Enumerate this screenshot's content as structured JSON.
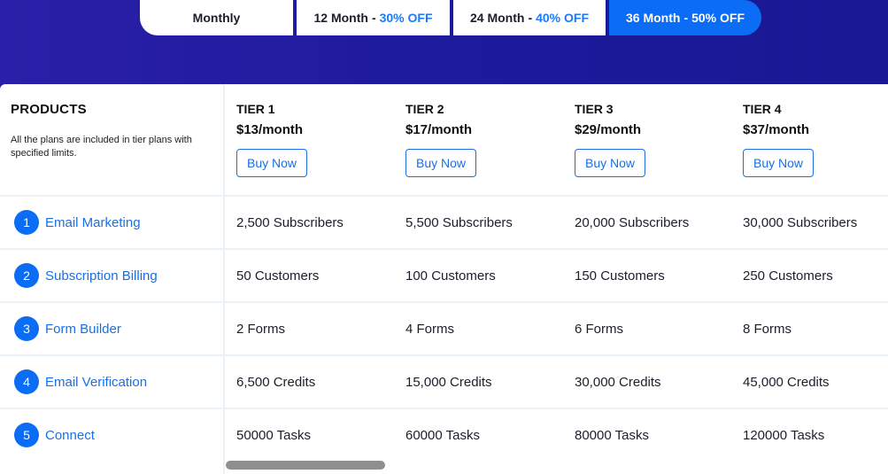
{
  "billing_tabs": [
    {
      "label": "Monthly",
      "discount": ""
    },
    {
      "label": "12 Month",
      "discount": "30% OFF"
    },
    {
      "label": "24 Month",
      "discount": "40% OFF"
    },
    {
      "label": "36 Month",
      "discount": "50% OFF"
    }
  ],
  "tab_separator": "-",
  "active_tab": "36 Month",
  "products_header": {
    "title": "PRODUCTS",
    "description": "All the plans are included in tier plans with specified limits."
  },
  "tiers": [
    {
      "name": "TIER 1",
      "price": "$13/month",
      "button": "Buy Now"
    },
    {
      "name": "TIER 2",
      "price": "$17/month",
      "button": "Buy Now"
    },
    {
      "name": "TIER 3",
      "price": "$29/month",
      "button": "Buy Now"
    },
    {
      "name": "TIER 4",
      "price": "$37/month",
      "button": "Buy Now"
    }
  ],
  "products": [
    {
      "num": "1",
      "name": "Email Marketing",
      "values": [
        "2,500 Subscribers",
        "5,500 Subscribers",
        "20,000 Subscribers",
        "30,000 Subscribers"
      ]
    },
    {
      "num": "2",
      "name": "Subscription Billing",
      "values": [
        "50 Customers",
        "100 Customers",
        "150 Customers",
        "250 Customers"
      ]
    },
    {
      "num": "3",
      "name": "Form Builder",
      "values": [
        "2 Forms",
        "4 Forms",
        "6 Forms",
        "8 Forms"
      ]
    },
    {
      "num": "4",
      "name": "Email Verification",
      "values": [
        "6,500 Credits",
        "15,000 Credits",
        "30,000 Credits",
        "45,000 Credits"
      ]
    },
    {
      "num": "5",
      "name": "Connect",
      "values": [
        "50000 Tasks",
        "60000 Tasks",
        "80000 Tasks",
        "120000 Tasks"
      ]
    }
  ],
  "colors": {
    "accent": "#0b6cf5",
    "hero": "#1d1a9c",
    "link": "#1a6fe6"
  }
}
